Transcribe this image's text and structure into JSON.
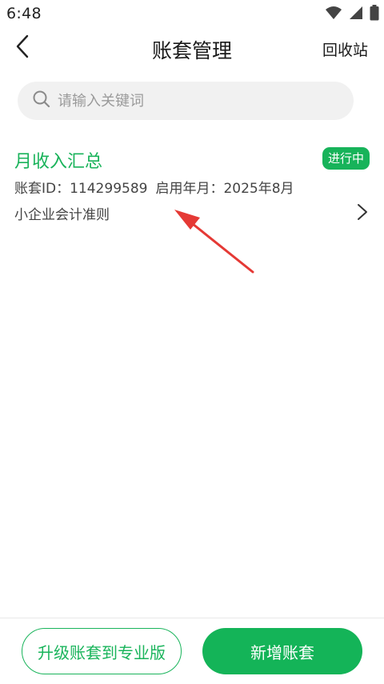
{
  "status_bar": {
    "time": "6:48"
  },
  "nav": {
    "title": "账套管理",
    "recycle_label": "回收站",
    "back_icon": "chevron-left-icon"
  },
  "search": {
    "placeholder": "请输入关键词",
    "value": "",
    "icon": "search-icon"
  },
  "ledger": {
    "name": "月收入汇总",
    "status": "进行中",
    "id_label": "账套ID：",
    "id_value": "114299589",
    "start_label": "启用年月：",
    "start_value": "2025年8月",
    "standard": "小企业会计准则"
  },
  "actions": {
    "upgrade_label": "升级账套到专业版",
    "new_label": "新增账套"
  },
  "colors": {
    "accent": "#14b458",
    "annotation": "#e53935"
  }
}
